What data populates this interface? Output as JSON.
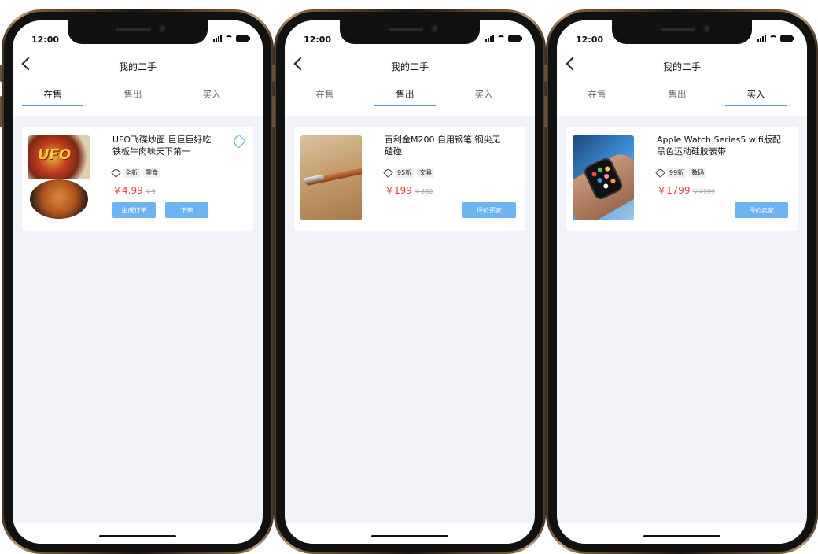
{
  "status": {
    "time": "12:00"
  },
  "nav": {
    "title": "我的二手"
  },
  "tabs": [
    "在售",
    "售出",
    "买入"
  ],
  "colors": {
    "accent": "#4a9ee8",
    "price": "#e83d35",
    "button": "#6fb3f0"
  },
  "screens": [
    {
      "active_tab": "在售",
      "item": {
        "title": "UFO飞碟炒面 巨巨巨好吃 铁板牛肉味天下第一",
        "image_text": "UFO",
        "condition": "全新",
        "category": "零食",
        "price": "￥4.99",
        "original_price": "￥5",
        "buttons": [
          "生成订单",
          "下架"
        ],
        "icon": "edit-icon"
      }
    },
    {
      "active_tab": "售出",
      "item": {
        "title": "百利金M200 自用钢笔 钢尖无磕碰",
        "condition": "95新",
        "category": "文具",
        "price": "￥199",
        "original_price": "￥880",
        "buttons": [
          "评价买家"
        ]
      }
    },
    {
      "active_tab": "买入",
      "item": {
        "title": "Apple Watch Series5 wifi版配黑色运动硅胶表带",
        "condition": "99新",
        "category": "数码",
        "price": "￥1799",
        "original_price": "￥4799",
        "buttons": [
          "评价卖家"
        ]
      }
    }
  ]
}
